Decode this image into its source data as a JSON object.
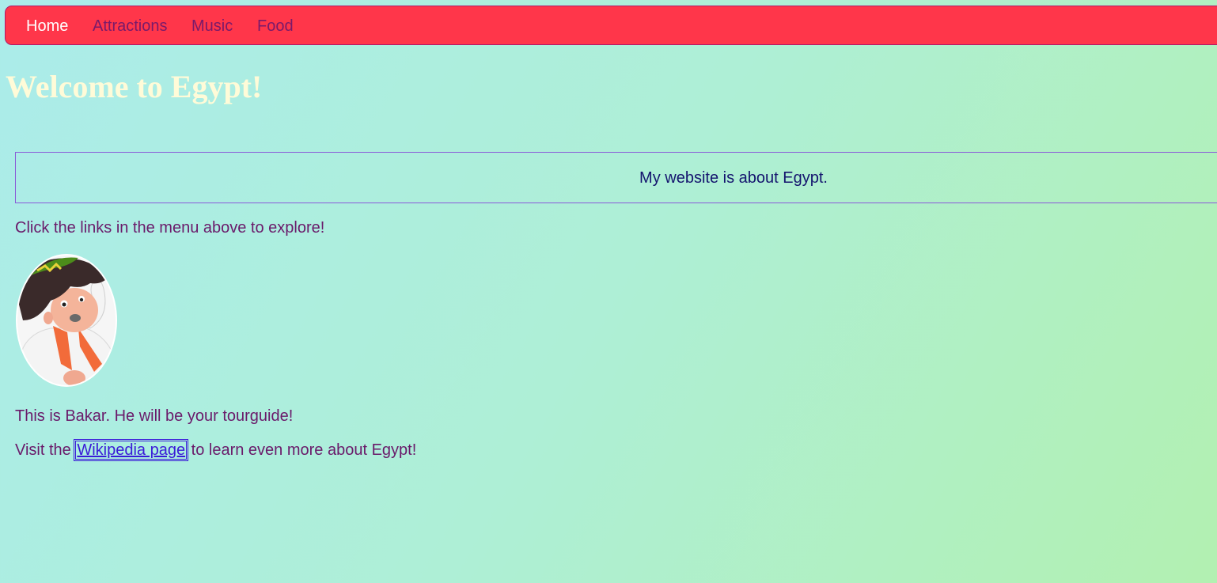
{
  "nav": {
    "items": [
      {
        "label": "Home",
        "active": true
      },
      {
        "label": "Attractions",
        "active": false
      },
      {
        "label": "Music",
        "active": false
      },
      {
        "label": "Food",
        "active": false
      }
    ]
  },
  "header": {
    "title": "Welcome to Egypt!"
  },
  "main": {
    "about_text": "My website is about Egypt.",
    "explore_text": "Click the links in the menu above to explore!",
    "guide_text": "This is Bakar. He will be your tourguide!",
    "visit_prefix": "Visit the ",
    "wiki_link_label": "Wikipedia page",
    "visit_suffix": " to learn even more about Egypt!"
  },
  "colors": {
    "nav_background": "#ff364a",
    "nav_border": "#b0186a",
    "nav_link": "#7a1a6a",
    "nav_link_active": "#ffffff",
    "title": "#fffbd8",
    "body_text": "#6a1a6a",
    "about_text": "#14146e",
    "about_border": "#8a5ad8",
    "link": "#3a1ad8"
  },
  "icons": {
    "avatar": "cartoon-boy-bakar-icon"
  }
}
